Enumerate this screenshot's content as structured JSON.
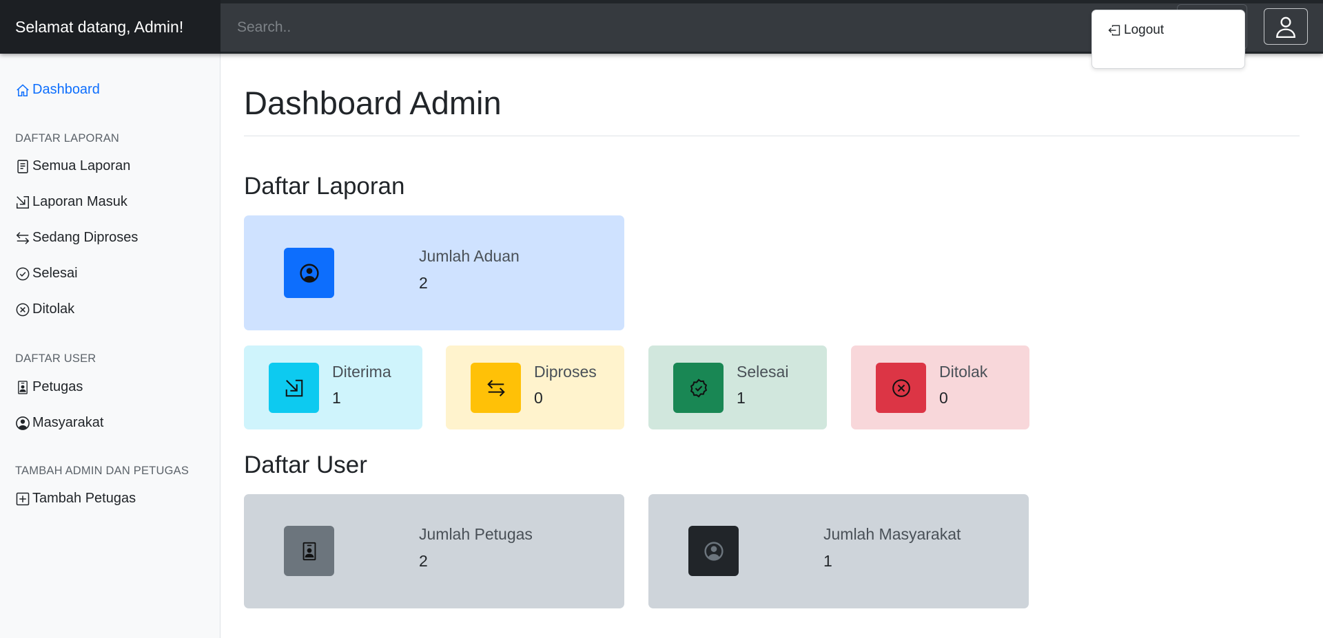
{
  "navbar": {
    "brand": "Selamat datang, Admin!",
    "search_placeholder": "Search..",
    "user_icon": "person-icon"
  },
  "dropdown": {
    "logout_label": "Logout",
    "logout_icon": "box-arrow-left-icon"
  },
  "sidebar": {
    "dashboard": "Dashboard",
    "heading_laporan": "DAFTAR LAPORAN",
    "semua_laporan": "Semua Laporan",
    "laporan_masuk": "Laporan Masuk",
    "sedang_diproses": "Sedang Diproses",
    "selesai": "Selesai",
    "ditolak": "Ditolak",
    "heading_user": "DAFTAR USER",
    "petugas": "Petugas",
    "masyarakat": "Masyarakat",
    "heading_tambah": "TAMBAH ADMIN DAN PETUGAS",
    "tambah_petugas": "Tambah Petugas"
  },
  "main": {
    "page_title": "Dashboard Admin",
    "section_laporan": "Daftar Laporan",
    "section_user": "Daftar User",
    "jumlah_aduan": {
      "label": "Jumlah Aduan",
      "value": "2"
    },
    "diterima": {
      "label": "Diterima",
      "value": "1"
    },
    "diproses": {
      "label": "Diproses",
      "value": "0"
    },
    "selesai": {
      "label": "Selesai",
      "value": "1"
    },
    "ditolak": {
      "label": "Ditolak",
      "value": "0"
    },
    "jumlah_petugas": {
      "label": "Jumlah Petugas",
      "value": "2"
    },
    "jumlah_masyarakat": {
      "label": "Jumlah Masyarakat",
      "value": "1"
    }
  },
  "colors": {
    "primary": "#0d6efd",
    "info": "#0dcaf0",
    "warning": "#ffc107",
    "success": "#198754",
    "danger": "#dc3545",
    "secondary": "#6c757d",
    "dark": "#212529"
  }
}
